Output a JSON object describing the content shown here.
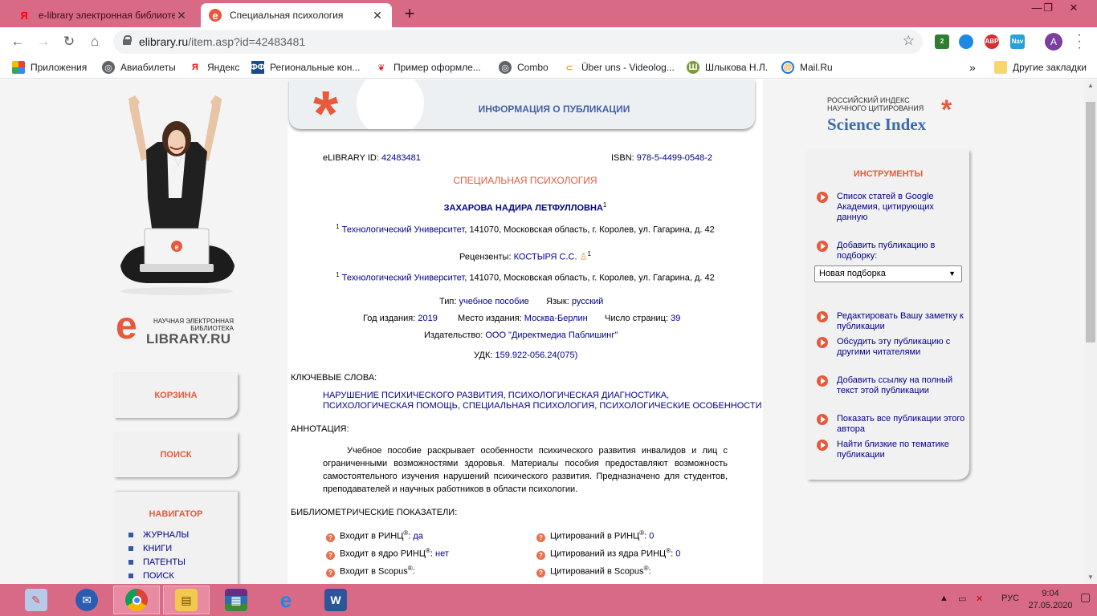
{
  "browser": {
    "tabs": [
      {
        "title": "e-library электронная библиотека",
        "favicon": "Я",
        "active": false
      },
      {
        "title": "Специальная психология",
        "favicon": "e",
        "active": true
      }
    ],
    "url_host": "elibrary.ru",
    "url_path": "/item.asp?id=42483481",
    "extensions": [
      {
        "name": "puzzle-extension",
        "badge": "2",
        "color": "#2e7d32"
      },
      {
        "name": "cloud-extension",
        "badge": "",
        "color": "#1e88e5"
      },
      {
        "name": "adblock-extension",
        "badge": "ABP",
        "color": "#d32f2f"
      },
      {
        "name": "nav-extension",
        "badge": "Nav",
        "color": "#29a0d8"
      }
    ],
    "avatar_letter": "A",
    "bookmarks": [
      {
        "label": "Приложения",
        "icon": "apps-grid-icon"
      },
      {
        "label": "Авиабилеты",
        "icon": "globe-icon"
      },
      {
        "label": "Яндекс",
        "icon": "yandex-icon"
      },
      {
        "label": "Региональные кон...",
        "icon": "rf-icon"
      },
      {
        "label": "Пример оформле...",
        "icon": "red-icon"
      },
      {
        "label": "Combo",
        "icon": "globe-icon"
      },
      {
        "label": "Über uns - Videolog...",
        "icon": "speech-icon"
      },
      {
        "label": "Шлыкова Н.Л.",
        "icon": "sh-icon"
      },
      {
        "label": "Mail.Ru",
        "icon": "mail-icon"
      }
    ],
    "bookmarks_more": "»",
    "other_bookmarks": "Другие закладки"
  },
  "left": {
    "logo_small": "НАУЧНАЯ ЭЛЕКТРОННАЯ БИБЛИОТЕКА",
    "logo_big": "LIBRARY.RU",
    "logo_letter": "e",
    "cart": "КОРЗИНА",
    "search": "ПОИСК",
    "navigator": "НАВИГАТОР",
    "nav_items": [
      "ЖУРНАЛЫ",
      "КНИГИ",
      "ПАТЕНТЫ",
      "ПОИСК"
    ]
  },
  "center": {
    "header": "ИНФОРМАЦИЯ О ПУБЛИКАЦИИ",
    "elibrary_id_label": "eLIBRARY ID:",
    "elibrary_id": "42483481",
    "isbn_label": "ISBN:",
    "isbn": "978-5-4499-0548-2",
    "title": "СПЕЦИАЛЬНАЯ ПСИХОЛОГИЯ",
    "author": "ЗАХАРОВА НАДИРА ЛЕТФУЛЛОВНА",
    "author_sup": "1",
    "affiliation_sup": "1",
    "affiliation_org": "Технологический Университет",
    "affiliation_addr": ", 141070, Московская область, г. Королев, ул. Гагарина, д. 42",
    "reviewers_label": "Рецензенты:",
    "reviewer": "КОСТЫРЯ С.С.",
    "reviewer_sup": "1",
    "type_label": "Тип:",
    "type": "учебное пособие",
    "lang_label": "Язык:",
    "lang": "русский",
    "year_label": "Год издания:",
    "year": "2019",
    "place_label": "Место издания:",
    "place": "Москва-Берлин",
    "pages_label": "Число страниц:",
    "pages": "39",
    "publisher_label": "Издательство:",
    "publisher": "ООО \"Директмедиа Паблишинг\"",
    "udk_label": "УДК:",
    "udk": "159.922-056.24(075)",
    "keywords_label": "КЛЮЧЕВЫЕ СЛОВА:",
    "keywords_line1": "НАРУШЕНИЕ ПСИХИЧЕСКОГО РАЗВИТИЯ, ПСИХОЛОГИЧЕСКАЯ ДИАГНОСТИКА,",
    "keywords_line2": "ПСИХОЛОГИЧЕСКАЯ ПОМОЩЬ, СПЕЦИАЛЬНАЯ ПСИХОЛОГИЯ, ПСИХОЛОГИЧЕСКИЕ ОСОБЕННОСТИ",
    "abstract_label": "АННОТАЦИЯ:",
    "abstract": "Учебное пособие раскрывает особенности психического развития инвалидов и лиц с ограниченными возможностями здоровья. Материалы пособия предоставляют возможность самостоятельного изучения нарушений психического развития. Предназначено для студентов, преподавателей и научных работников в области психологии.",
    "biblio_label": "БИБЛИОМЕТРИЧЕСКИЕ ПОКАЗАТЕЛИ:",
    "metrics_left": [
      {
        "label": "Входит в РИНЦ",
        "value": "да"
      },
      {
        "label": "Входит в ядро РИНЦ",
        "value": "нет"
      },
      {
        "label": "Входит в Scopus",
        "value": ""
      }
    ],
    "metrics_right": [
      {
        "label": "Цитирований в РИНЦ",
        "value": "0"
      },
      {
        "label": "Цитирований из ядра РИНЦ",
        "value": "0"
      },
      {
        "label": "Цитирований в Scopus",
        "value": ""
      }
    ],
    "reg_mark": "®",
    "help_mark": "?"
  },
  "right": {
    "si_small_1": "РОССИЙСКИЙ ИНДЕКС",
    "si_small_2": "НАУЧНОГО ЦИТИРОВАНИЯ",
    "si_big": "Science Index",
    "tools_title": "ИНСТРУМЕНТЫ",
    "tools": [
      "Список статей в Google Академия, цитирующих данную",
      "Добавить публикацию в подборку:",
      "Редактировать Вашу заметку к публикации",
      "Обсудить эту публикацию с другими читателями",
      "Добавить ссылку на полный текст этой публикации",
      "Показать все публикации этого автора",
      "Найти близкие по тематике публикации"
    ],
    "select_value": "Новая подборка"
  },
  "taskbar": {
    "lang": "РУС",
    "time": "9:04",
    "date": "27.05.2020"
  }
}
